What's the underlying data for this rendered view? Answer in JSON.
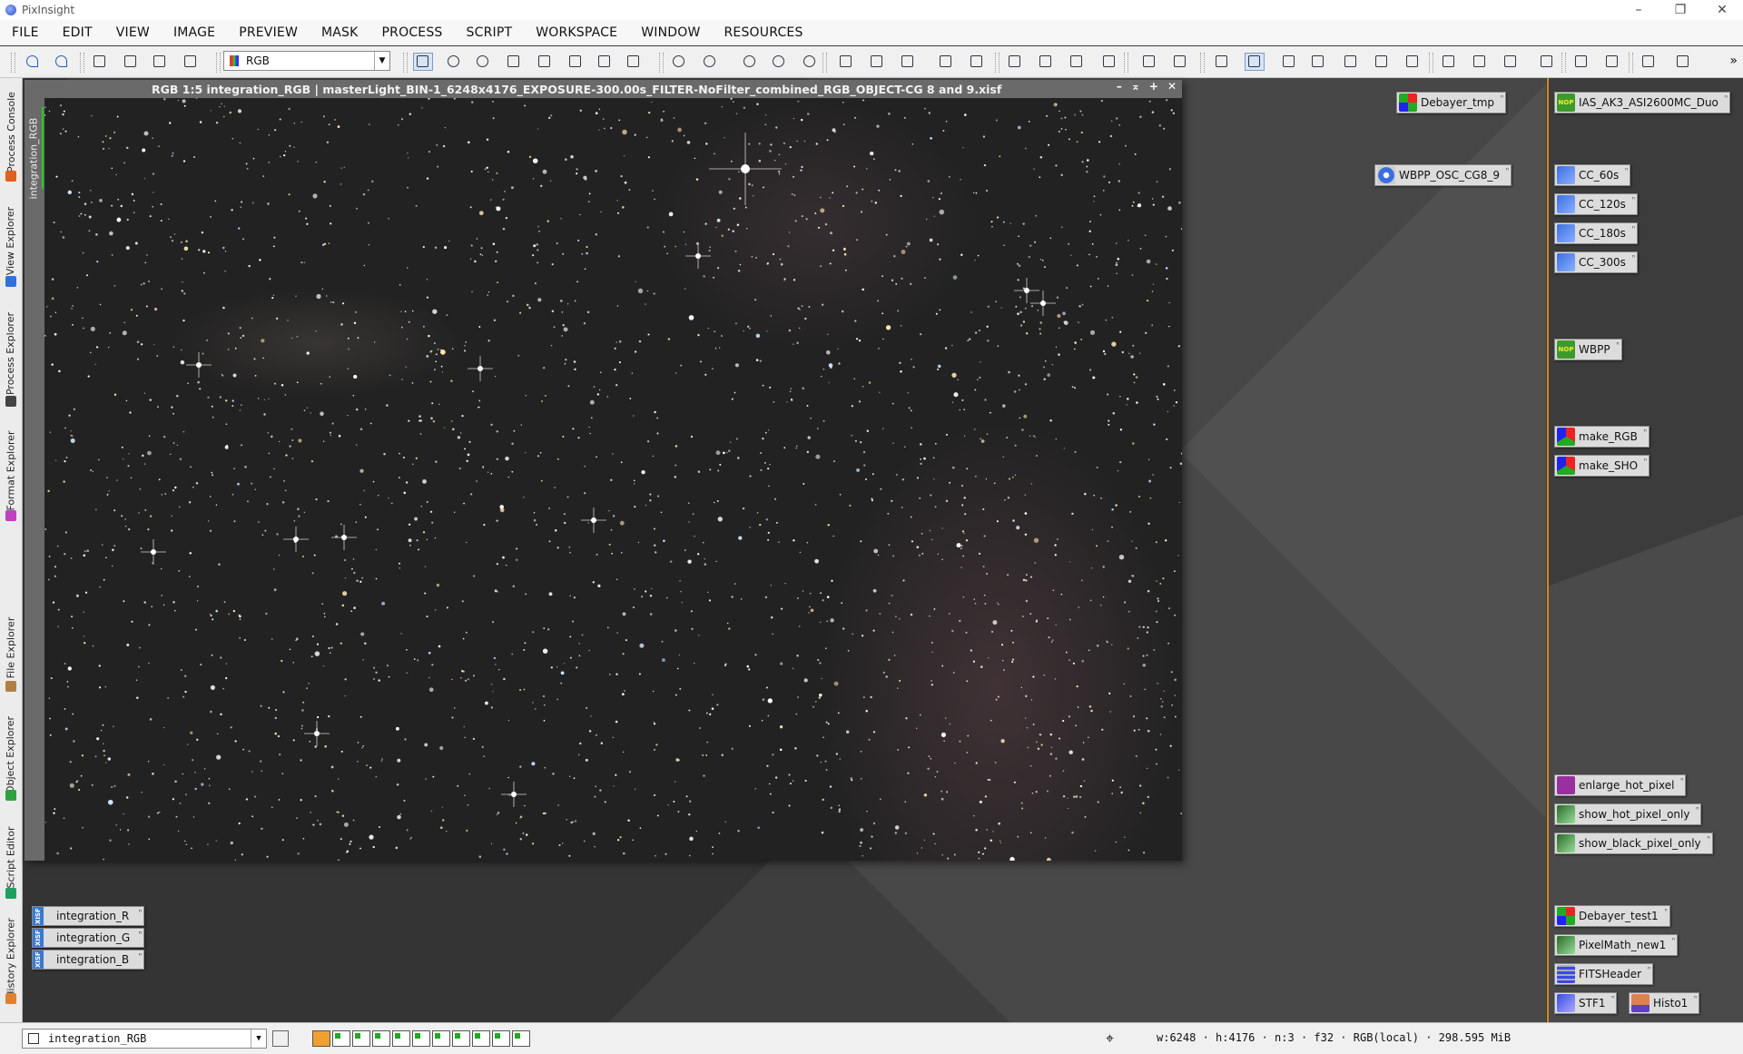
{
  "app": {
    "title": "PixInsight"
  },
  "window_controls": {
    "minimize": "–",
    "restore": "❐",
    "close": "✕"
  },
  "menu": [
    "FILE",
    "EDIT",
    "VIEW",
    "IMAGE",
    "PREVIEW",
    "MASK",
    "PROCESS",
    "SCRIPT",
    "WORKSPACE",
    "WINDOW",
    "RESOURCES"
  ],
  "toolbar": {
    "color_space": "RGB",
    "overflow_label": "»",
    "buttons": [
      "undo-icon",
      "redo-icon",
      "view-identifier-icon",
      "new-image-icon",
      "color-manage-icon",
      "rgb-channels-icon",
      "pan-mode-icon",
      "zoom-fit-icon",
      "zoom-fill-icon",
      "move-icon",
      "readout-icon",
      "preview-edit-icon",
      "preview-select-icon",
      "pointer-icon",
      "zoom-in-icon",
      "zoom-out-icon",
      "zoom-1-1-icon",
      "zoom-in-alt-icon",
      "zoom-out-alt-icon",
      "fit-view-icon",
      "optimal-fit-icon",
      "screen-stretch-icon",
      "resize-window-icon",
      "resize-image-icon",
      "mask-new-icon",
      "mask-enable-icon",
      "mask-show-icon",
      "mask-invert-icon",
      "stf-toggle-icon",
      "stf-auto-icon",
      "stf-reset-icon",
      "histogram-icon",
      "statistics-icon",
      "preview-new-icon",
      "preview-delete-icon",
      "preview-store-icon",
      "preview-restore-icon",
      "workspace-1-icon",
      "workspace-2-icon",
      "workspace-3-icon",
      "workspace-4-icon",
      "console-icon",
      "explorer-icon",
      "fullscreen-icon",
      "tile-icon",
      "close-all-icon",
      "close-icon"
    ]
  },
  "sidebar": {
    "tabs": [
      "Process Console",
      "View Explorer",
      "Process Explorer",
      "Format Explorer",
      "File Explorer",
      "Object Explorer",
      "Script Editor",
      "History Explorer"
    ],
    "tab_colors": [
      "#e06020",
      "#3070e0",
      "#444444",
      "#c040c0",
      "#b08040",
      "#30a040",
      "#20a060",
      "#e08030"
    ]
  },
  "image_window": {
    "title": "RGB 1:5 integration_RGB | masterLight_BIN-1_6248x4176_EXPOSURE-300.00s_FILTER-NoFilter_combined_RGB_OBJECT-CG 8 and 9.xisf",
    "side_label": "integration_RGB",
    "buttons": [
      "–",
      "⌅",
      "+",
      "✕"
    ]
  },
  "process_icons": [
    {
      "label": "Debayer_tmp",
      "glyph": "g-debayer",
      "nop": ""
    },
    {
      "label": "WBPP_OSC_CG8_9",
      "glyph": "g-wbpp",
      "nop": ""
    },
    {
      "label": "IAS_AK3_ASI2600MC_Duo",
      "glyph": "g-nop",
      "nop": "NOP"
    },
    {
      "label": "CC_60s",
      "glyph": "g-cc",
      "nop": ""
    },
    {
      "label": "CC_120s",
      "glyph": "g-cc",
      "nop": ""
    },
    {
      "label": "CC_180s",
      "glyph": "g-cc",
      "nop": ""
    },
    {
      "label": "CC_300s",
      "glyph": "g-cc",
      "nop": ""
    },
    {
      "label": "WBPP",
      "glyph": "g-nop",
      "nop": "NOP"
    },
    {
      "label": "make_RGB",
      "glyph": "g-make",
      "nop": ""
    },
    {
      "label": "make_SHO",
      "glyph": "g-make",
      "nop": ""
    },
    {
      "label": "enlarge_hot_pixel",
      "glyph": "g-enlarge",
      "nop": ""
    },
    {
      "label": "show_hot_pixel_only",
      "glyph": "g-pm",
      "nop": ""
    },
    {
      "label": "show_black_pixel_only",
      "glyph": "g-pm",
      "nop": ""
    },
    {
      "label": "Debayer_test1",
      "glyph": "g-debayer",
      "nop": ""
    },
    {
      "label": "PixelMath_new1",
      "glyph": "g-pm",
      "nop": ""
    },
    {
      "label": "FITSHeader",
      "glyph": "g-fits",
      "nop": ""
    },
    {
      "label": "STF1",
      "glyph": "g-stf",
      "nop": ""
    },
    {
      "label": "Histo1",
      "glyph": "g-histo",
      "nop": ""
    }
  ],
  "image_icons": [
    {
      "label": "integration_R",
      "badge": "XISF"
    },
    {
      "label": "integration_G",
      "badge": "XISF"
    },
    {
      "label": "integration_B",
      "badge": "XISF"
    }
  ],
  "icon_marker": "ⁿ",
  "statusbar": {
    "active_view": "integration_RGB",
    "info": "w:6248 · h:4176 · n:3 · f32 · RGB(local) · 298.595 MiB",
    "crosshair": "⌖"
  }
}
